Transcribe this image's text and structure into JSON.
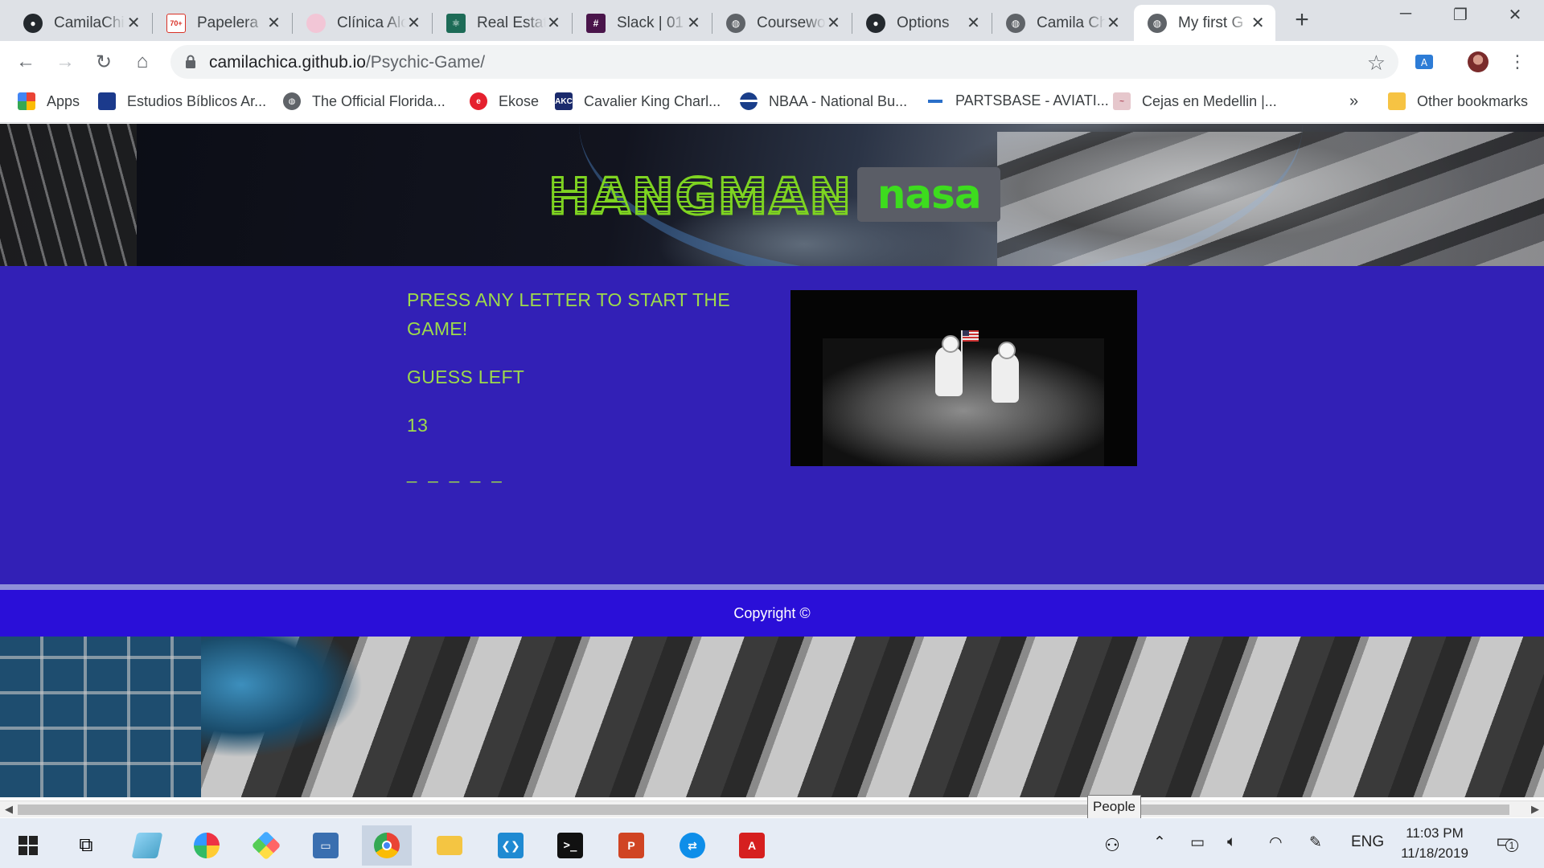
{
  "browser": {
    "tabs": [
      {
        "title": "CamilaChica",
        "icon": "github-icon",
        "color": "#24292e"
      },
      {
        "title": "Papelera",
        "icon": "gmail-icon",
        "color": "#d93025",
        "badge": "70+"
      },
      {
        "title": "Clínica Alc",
        "icon": "clinic-icon",
        "color": "#e08fb0"
      },
      {
        "title": "Real Estate",
        "icon": "react-icon",
        "color": "#1d6b57"
      },
      {
        "title": "Slack | 01",
        "icon": "slack-icon",
        "color": "#4a154b"
      },
      {
        "title": "Coursework",
        "icon": "globe-icon",
        "color": "#5f6368"
      },
      {
        "title": "Options",
        "icon": "github-icon",
        "color": "#24292e"
      },
      {
        "title": "Camila Ch",
        "icon": "globe-icon",
        "color": "#5f6368"
      },
      {
        "title": "My first G",
        "icon": "globe-icon",
        "color": "#5f6368",
        "active": true
      }
    ],
    "url_host": "camilachica.github.io",
    "url_path": "/Psychic-Game/",
    "bookmarks": [
      {
        "label": "Apps",
        "icon": "apps-grid-icon"
      },
      {
        "label": "Estudios Bíblicos Ar...",
        "icon": "bible-site-icon"
      },
      {
        "label": "The Official Florida...",
        "icon": "globe-icon"
      },
      {
        "label": "Ekose",
        "icon": "ekose-icon"
      },
      {
        "label": "Cavalier King Charl...",
        "icon": "akc-icon",
        "badge": "AKC"
      },
      {
        "label": "NBAA - National Bu...",
        "icon": "nbaa-icon"
      },
      {
        "label": "PARTSBASE - AVIATI...",
        "icon": "partsbase-icon"
      },
      {
        "label": "Cejas en Medellin |...",
        "icon": "cejas-icon"
      }
    ],
    "bookmarks_overflow": "»",
    "other_bookmarks": "Other bookmarks"
  },
  "page": {
    "title_main": "HANGMAN",
    "title_badge": "nasa",
    "prompt": "PRESS ANY LETTER TO START THE GAME!",
    "guess_label": "GUESS LEFT",
    "guess_count": "13",
    "word_blanks": "_ _ _ _ _",
    "copyright": "Copyright ©"
  },
  "tooltip": "People",
  "taskbar": {
    "language": "ENG",
    "time": "11:03 PM",
    "date": "11/18/2019",
    "notification_count": "1"
  },
  "colors": {
    "game_bg": "#3220b6",
    "game_text": "#9edb4a",
    "footer_bg": "#2a0fd8",
    "title_green": "#7ed321"
  }
}
